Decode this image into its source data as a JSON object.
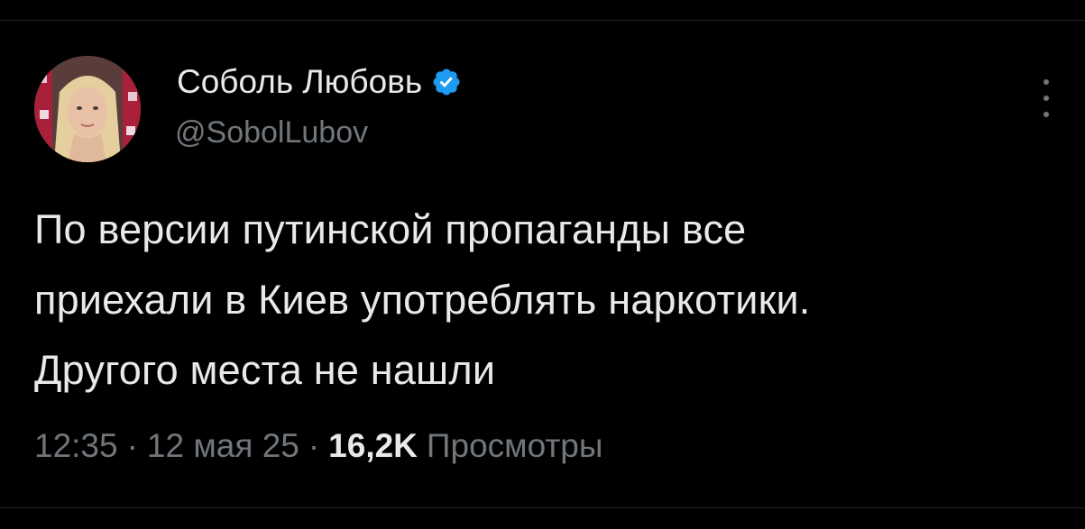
{
  "tweet": {
    "author_name": "Соболь Любовь",
    "handle": "@SobolLubov",
    "verified": true,
    "lines": [
      "По версии путинской пропаганды все",
      "приехали в Киев употреблять наркотики.",
      "Другого места не нашли"
    ],
    "time": "12:35",
    "date": "12 мая 25",
    "separator": "·",
    "views_count": "16,2K",
    "views_label": "Просмотры"
  },
  "colors": {
    "background": "#000000",
    "text_primary": "#e7e9ea",
    "text_secondary": "#71767b",
    "verified_badge": "#1d9bf0"
  },
  "icons": {
    "verified": "verified-badge-icon",
    "more": "more-vertical-icon"
  }
}
